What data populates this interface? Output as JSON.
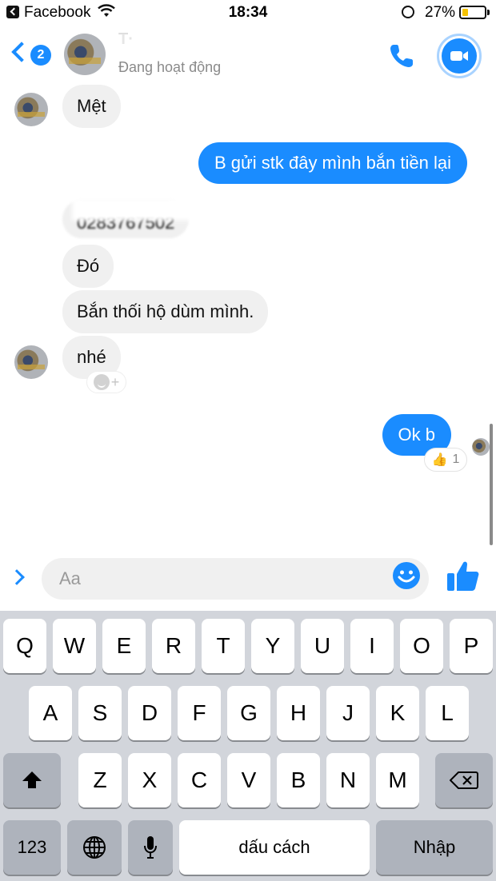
{
  "status_bar": {
    "back_app": "Facebook",
    "time": "18:34",
    "battery_percent": "27%",
    "battery_level": 0.27,
    "battery_color": "#f5c200",
    "icons": [
      "wifi-icon",
      "rotation-lock-icon",
      "battery-icon"
    ]
  },
  "header": {
    "back_badge": "2",
    "contact_name": "T·",
    "active_status": "Đang hoạt động",
    "actions": [
      "phone-icon",
      "video-camera-icon"
    ],
    "accent_color": "#1a8cff"
  },
  "messages": [
    {
      "sender": "contact",
      "text": "Mệt"
    },
    {
      "sender": "me",
      "text": "B gửi stk đây mình bắn tiền lại"
    },
    {
      "sender": "contact",
      "text": "0283767502",
      "obscured": true
    },
    {
      "sender": "contact",
      "text": "Đó"
    },
    {
      "sender": "contact",
      "text": "Bắn thối hộ dùm mình."
    },
    {
      "sender": "contact",
      "text": "nhé"
    },
    {
      "sender": "me",
      "text": "Ok b",
      "reaction": "👍",
      "reaction_count": "1"
    }
  ],
  "reaction_add": {
    "symbol": "+"
  },
  "composer": {
    "placeholder": "Aa",
    "value": ""
  },
  "keyboard": {
    "row1": [
      "Q",
      "W",
      "E",
      "R",
      "T",
      "Y",
      "U",
      "I",
      "O",
      "P"
    ],
    "row2": [
      "A",
      "S",
      "D",
      "F",
      "G",
      "H",
      "J",
      "K",
      "L"
    ],
    "row3": [
      "Z",
      "X",
      "C",
      "V",
      "B",
      "N",
      "M"
    ],
    "numbers_key": "123",
    "space_key": "dấu cách",
    "return_key": "Nhập"
  }
}
